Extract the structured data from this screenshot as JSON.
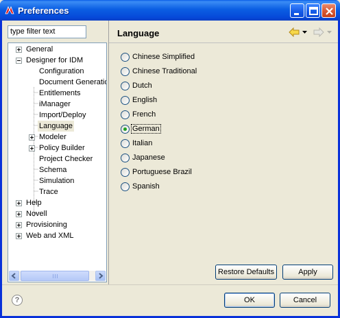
{
  "window": {
    "title": "Preferences",
    "titlebar_color": "#0b5fe3"
  },
  "filter": {
    "placeholder": "type filter text",
    "value": "type filter text"
  },
  "tree": {
    "items": [
      {
        "label": "General",
        "expander": "plus"
      },
      {
        "label": "Designer for IDM",
        "expander": "minus"
      },
      {
        "label": "Configuration",
        "expander": "none"
      },
      {
        "label": "Document Generatior",
        "expander": "none"
      },
      {
        "label": "Entitlements",
        "expander": "none"
      },
      {
        "label": "iManager",
        "expander": "none"
      },
      {
        "label": "Import/Deploy",
        "expander": "none"
      },
      {
        "label": "Language",
        "expander": "none",
        "selected": true
      },
      {
        "label": "Modeler",
        "expander": "plus"
      },
      {
        "label": "Policy Builder",
        "expander": "plus"
      },
      {
        "label": "Project Checker",
        "expander": "none"
      },
      {
        "label": "Schema",
        "expander": "none"
      },
      {
        "label": "Simulation",
        "expander": "none"
      },
      {
        "label": "Trace",
        "expander": "none"
      },
      {
        "label": "Help",
        "expander": "plus"
      },
      {
        "label": "Novell",
        "expander": "plus"
      },
      {
        "label": "Provisioning",
        "expander": "plus"
      },
      {
        "label": "Web and XML",
        "expander": "plus"
      }
    ]
  },
  "page": {
    "title": "Language"
  },
  "nav": {
    "back_icon": "back-arrow-icon",
    "forward_icon": "forward-arrow-icon"
  },
  "languages": {
    "options": [
      "Chinese Simplified",
      "Chinese Traditional",
      "Dutch",
      "English",
      "French",
      "German",
      "Italian",
      "Japanese",
      "Portuguese Brazil",
      "Spanish"
    ],
    "selected": "German"
  },
  "buttons": {
    "restore_defaults": "Restore Defaults",
    "apply": "Apply",
    "ok": "OK",
    "cancel": "Cancel"
  }
}
